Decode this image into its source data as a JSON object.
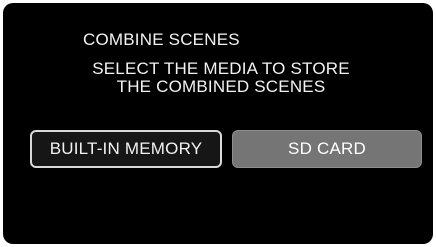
{
  "dialog": {
    "title": "COMBINE SCENES",
    "message_line1": "SELECT THE MEDIA TO STORE",
    "message_line2": "THE COMBINED SCENES"
  },
  "options": {
    "builtin_label": "BUILT-IN MEMORY",
    "sd_label": "SD CARD",
    "selected": "BUILT-IN MEMORY"
  },
  "colors": {
    "screen_background": "#000000",
    "text": "#f2f2f2",
    "selected_border": "#d9d9d9",
    "unselected_button": "#757575"
  }
}
